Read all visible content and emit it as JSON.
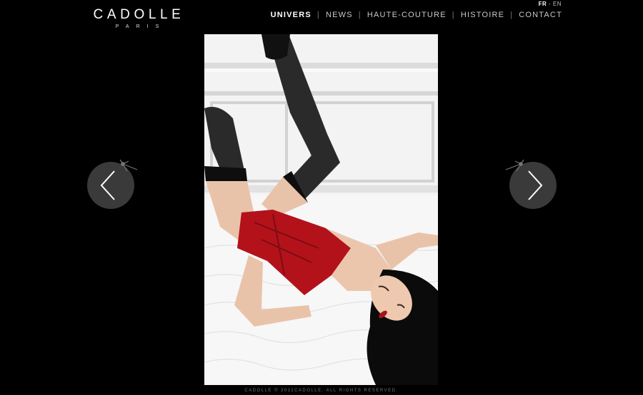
{
  "brand": {
    "name": "CADOLLE",
    "city": "PARIS"
  },
  "language": {
    "active": "FR",
    "separator": "-",
    "other": "EN"
  },
  "nav": {
    "items": [
      {
        "label": "UNIVERS",
        "active": true
      },
      {
        "label": "NEWS",
        "active": false
      },
      {
        "label": "HAUTE-COUTURE",
        "active": false
      },
      {
        "label": "HISTOIRE",
        "active": false
      },
      {
        "label": "CONTACT",
        "active": false
      }
    ],
    "separator": "|"
  },
  "gallery": {
    "photo": "woman-in-red-satin-corset-and-black-stockings",
    "prev_icon": "chevron-left-icon",
    "next_icon": "chevron-right-icon"
  },
  "footer": {
    "text": "CADOLLE © 2011CADOLLE. ALL RIGHTS RESERVED."
  },
  "colors": {
    "background": "#000000",
    "arrow_circle": "#3a3a3a",
    "accent_red": "#b3121b"
  }
}
